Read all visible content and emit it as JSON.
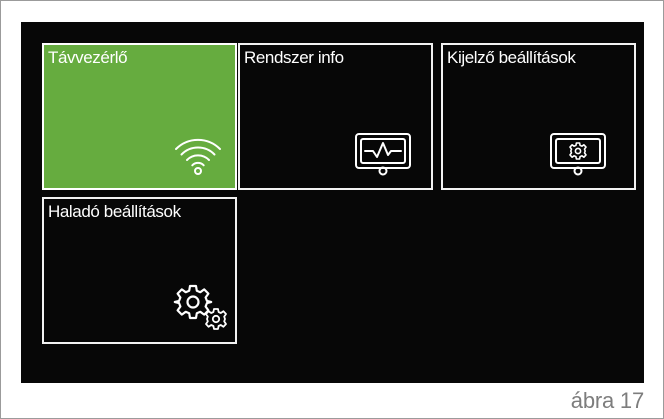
{
  "tiles": [
    {
      "label": "Távvezérlő",
      "icon": "wifi-icon",
      "selected": true
    },
    {
      "label": "Rendszer info",
      "icon": "monitor-waveform-icon",
      "selected": false
    },
    {
      "label": "Kijelző beállítások",
      "icon": "monitor-gear-icon",
      "selected": false
    },
    {
      "label": "Haladó beállítások",
      "icon": "gears-icon",
      "selected": false
    }
  ],
  "figure_caption": "ábra 17",
  "colors": {
    "screen_background": "#070707",
    "selected_tile": "#66ac3f",
    "tile_border": "#f2f2f2",
    "caption_text": "#7d7d7d"
  }
}
